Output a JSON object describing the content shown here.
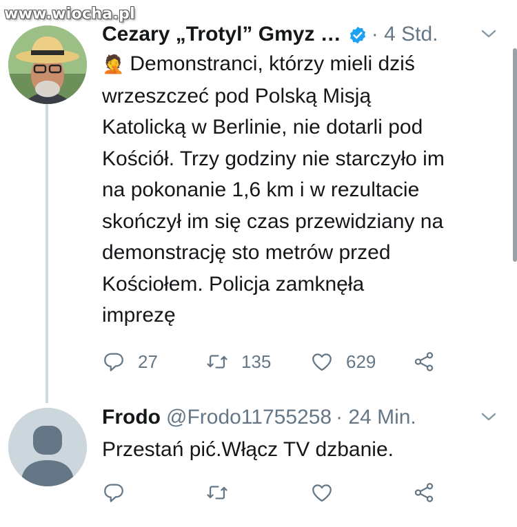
{
  "watermark": "www.wiocha.pl",
  "tweet1": {
    "name": "Cezary „Trotyl” Gmyz …",
    "time": "· 4 Std.",
    "emoji": "🤦",
    "text": "Demonstranci, którzy mieli dziś\nwrzeszczeć pod Polską Misją\nKatolicką w Berlinie, nie dotarli pod\nKościół. Trzy godziny nie starczyło im\nna pokonanie 1,6 km i w rezultacie\nskończył im się czas przewidziany na\ndemonstrację sto metrów przed\nKościołem.  Policja zamknęła\nimprezę",
    "replies": "27",
    "retweets": "135",
    "likes": "629"
  },
  "tweet2": {
    "name": "Frodo",
    "handle": "@Frodo11755258",
    "time": "· 24 Min.",
    "text": "Przestań pić.Włącz TV dzbanie.",
    "replies": "",
    "retweets": "",
    "likes": ""
  },
  "colors": {
    "text": "#14171a",
    "secondary": "#657786",
    "verified": "#1da1f2",
    "thread_line": "#cfd9de"
  }
}
